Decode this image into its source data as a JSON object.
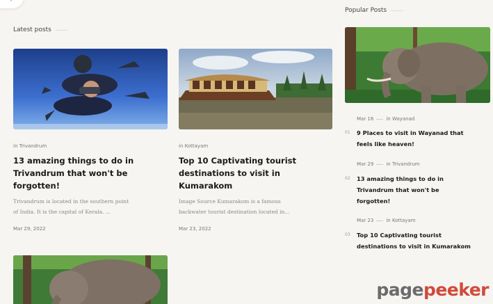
{
  "latest": {
    "heading": "Latest posts",
    "posts": [
      {
        "category_prefix": "in",
        "category": "Trivandrum",
        "title_lines": [
          "13 amazing things to do in",
          "Trivandrum that won't be",
          "forgotten!"
        ],
        "excerpt_lines": [
          "Trivandrum is located in the southern point",
          "of India. It is the capital of Kerala. ..."
        ],
        "date": "Mar 29, 2022",
        "image": "skydivers-image"
      },
      {
        "category_prefix": "in",
        "category": "Kottayam",
        "title_lines": [
          "Top 10 Captivating tourist",
          "destinations to visit in",
          "Kumarakom"
        ],
        "excerpt_lines": [
          "Image Source Kumarakom is a famous",
          "backwater tourist destination located in..."
        ],
        "date": "Mar 23, 2022",
        "image": "houseboat-image"
      }
    ],
    "partial_post_image": "elephant-image"
  },
  "popular": {
    "heading": "Popular Posts",
    "image": "elephant-image",
    "items": [
      {
        "number": "01",
        "date": "Mar 16",
        "category_prefix": "in",
        "category": "Wayanad",
        "title_lines": [
          "9 Places to visit in Wayanad that",
          "feels like heaven!"
        ]
      },
      {
        "number": "02",
        "date": "Mar 29",
        "category_prefix": "in",
        "category": "Trivandrum",
        "title_lines": [
          "13 amazing things to do in",
          "Trivandrum that won't be",
          "forgotten!"
        ]
      },
      {
        "number": "03",
        "date": "Mar 23",
        "category_prefix": "in",
        "category": "Kottayam",
        "title_lines": [
          "Top 10 Captivating tourist",
          "destinations to visit in Kumarakom"
        ]
      }
    ]
  },
  "watermark": {
    "part1": "page",
    "part2": "peeker"
  },
  "colors": {
    "background": "#f6f5f2",
    "watermark_accent": "#d24a3a",
    "text": "#1a1a1a"
  }
}
